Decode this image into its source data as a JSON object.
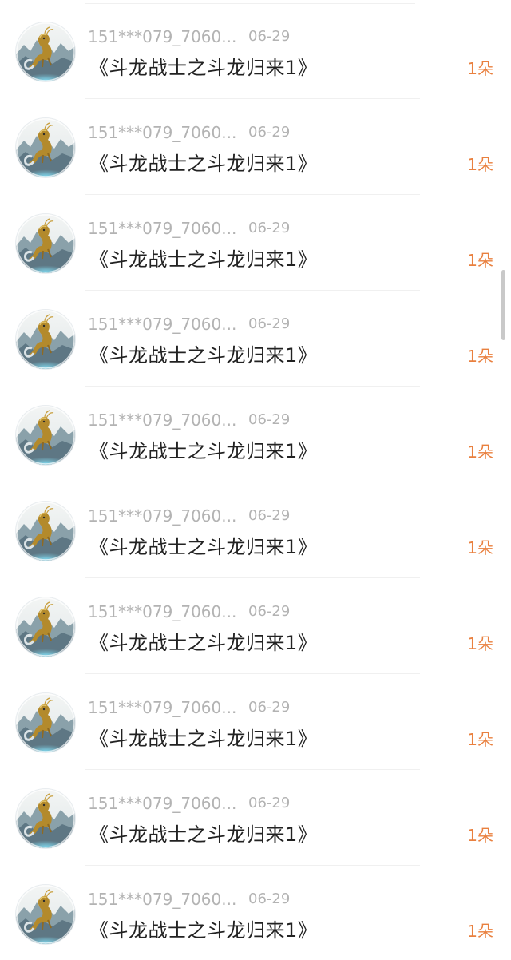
{
  "list": {
    "items": [
      {
        "username": "151***079_7060...",
        "date": "06-29",
        "title": "《斗龙战士之斗龙归来1》",
        "count": "1朵",
        "avatar_icon": "dragon-avatar-icon"
      },
      {
        "username": "151***079_7060...",
        "date": "06-29",
        "title": "《斗龙战士之斗龙归来1》",
        "count": "1朵",
        "avatar_icon": "dragon-avatar-icon"
      },
      {
        "username": "151***079_7060...",
        "date": "06-29",
        "title": "《斗龙战士之斗龙归来1》",
        "count": "1朵",
        "avatar_icon": "dragon-avatar-icon"
      },
      {
        "username": "151***079_7060...",
        "date": "06-29",
        "title": "《斗龙战士之斗龙归来1》",
        "count": "1朵",
        "avatar_icon": "dragon-avatar-icon"
      },
      {
        "username": "151***079_7060...",
        "date": "06-29",
        "title": "《斗龙战士之斗龙归来1》",
        "count": "1朵",
        "avatar_icon": "dragon-avatar-icon"
      },
      {
        "username": "151***079_7060...",
        "date": "06-29",
        "title": "《斗龙战士之斗龙归来1》",
        "count": "1朵",
        "avatar_icon": "dragon-avatar-icon"
      },
      {
        "username": "151***079_7060...",
        "date": "06-29",
        "title": "《斗龙战士之斗龙归来1》",
        "count": "1朵",
        "avatar_icon": "dragon-avatar-icon"
      },
      {
        "username": "151***079_7060...",
        "date": "06-29",
        "title": "《斗龙战士之斗龙归来1》",
        "count": "1朵",
        "avatar_icon": "dragon-avatar-icon"
      },
      {
        "username": "151***079_7060...",
        "date": "06-29",
        "title": "《斗龙战士之斗龙归来1》",
        "count": "1朵",
        "avatar_icon": "dragon-avatar-icon"
      },
      {
        "username": "151***079_7060...",
        "date": "06-29",
        "title": "《斗龙战士之斗龙归来1》",
        "count": "1朵",
        "avatar_icon": "dragon-avatar-icon"
      }
    ]
  },
  "colors": {
    "count_accent": "#e9803f",
    "meta_gray": "#b3b3b3",
    "title_text": "#222222"
  }
}
